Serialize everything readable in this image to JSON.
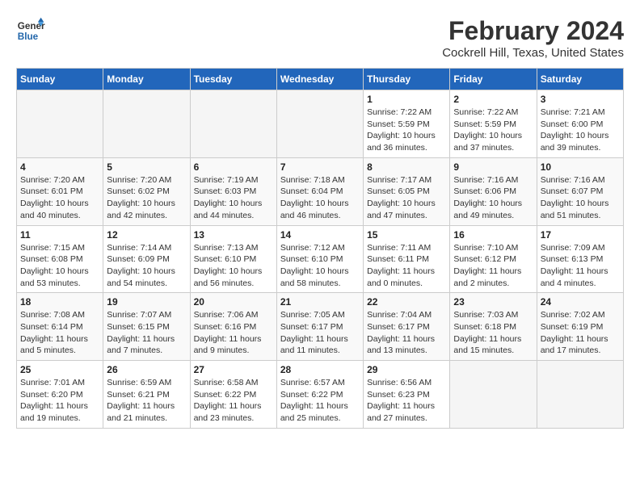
{
  "header": {
    "logo_line1": "General",
    "logo_line2": "Blue",
    "title": "February 2024",
    "subtitle": "Cockrell Hill, Texas, United States"
  },
  "weekdays": [
    "Sunday",
    "Monday",
    "Tuesday",
    "Wednesday",
    "Thursday",
    "Friday",
    "Saturday"
  ],
  "weeks": [
    [
      {
        "day": "",
        "sunrise": "",
        "sunset": "",
        "daylight": ""
      },
      {
        "day": "",
        "sunrise": "",
        "sunset": "",
        "daylight": ""
      },
      {
        "day": "",
        "sunrise": "",
        "sunset": "",
        "daylight": ""
      },
      {
        "day": "",
        "sunrise": "",
        "sunset": "",
        "daylight": ""
      },
      {
        "day": "1",
        "sunrise": "Sunrise: 7:22 AM",
        "sunset": "Sunset: 5:59 PM",
        "daylight": "Daylight: 10 hours and 36 minutes."
      },
      {
        "day": "2",
        "sunrise": "Sunrise: 7:22 AM",
        "sunset": "Sunset: 5:59 PM",
        "daylight": "Daylight: 10 hours and 37 minutes."
      },
      {
        "day": "3",
        "sunrise": "Sunrise: 7:21 AM",
        "sunset": "Sunset: 6:00 PM",
        "daylight": "Daylight: 10 hours and 39 minutes."
      }
    ],
    [
      {
        "day": "4",
        "sunrise": "Sunrise: 7:20 AM",
        "sunset": "Sunset: 6:01 PM",
        "daylight": "Daylight: 10 hours and 40 minutes."
      },
      {
        "day": "5",
        "sunrise": "Sunrise: 7:20 AM",
        "sunset": "Sunset: 6:02 PM",
        "daylight": "Daylight: 10 hours and 42 minutes."
      },
      {
        "day": "6",
        "sunrise": "Sunrise: 7:19 AM",
        "sunset": "Sunset: 6:03 PM",
        "daylight": "Daylight: 10 hours and 44 minutes."
      },
      {
        "day": "7",
        "sunrise": "Sunrise: 7:18 AM",
        "sunset": "Sunset: 6:04 PM",
        "daylight": "Daylight: 10 hours and 46 minutes."
      },
      {
        "day": "8",
        "sunrise": "Sunrise: 7:17 AM",
        "sunset": "Sunset: 6:05 PM",
        "daylight": "Daylight: 10 hours and 47 minutes."
      },
      {
        "day": "9",
        "sunrise": "Sunrise: 7:16 AM",
        "sunset": "Sunset: 6:06 PM",
        "daylight": "Daylight: 10 hours and 49 minutes."
      },
      {
        "day": "10",
        "sunrise": "Sunrise: 7:16 AM",
        "sunset": "Sunset: 6:07 PM",
        "daylight": "Daylight: 10 hours and 51 minutes."
      }
    ],
    [
      {
        "day": "11",
        "sunrise": "Sunrise: 7:15 AM",
        "sunset": "Sunset: 6:08 PM",
        "daylight": "Daylight: 10 hours and 53 minutes."
      },
      {
        "day": "12",
        "sunrise": "Sunrise: 7:14 AM",
        "sunset": "Sunset: 6:09 PM",
        "daylight": "Daylight: 10 hours and 54 minutes."
      },
      {
        "day": "13",
        "sunrise": "Sunrise: 7:13 AM",
        "sunset": "Sunset: 6:10 PM",
        "daylight": "Daylight: 10 hours and 56 minutes."
      },
      {
        "day": "14",
        "sunrise": "Sunrise: 7:12 AM",
        "sunset": "Sunset: 6:10 PM",
        "daylight": "Daylight: 10 hours and 58 minutes."
      },
      {
        "day": "15",
        "sunrise": "Sunrise: 7:11 AM",
        "sunset": "Sunset: 6:11 PM",
        "daylight": "Daylight: 11 hours and 0 minutes."
      },
      {
        "day": "16",
        "sunrise": "Sunrise: 7:10 AM",
        "sunset": "Sunset: 6:12 PM",
        "daylight": "Daylight: 11 hours and 2 minutes."
      },
      {
        "day": "17",
        "sunrise": "Sunrise: 7:09 AM",
        "sunset": "Sunset: 6:13 PM",
        "daylight": "Daylight: 11 hours and 4 minutes."
      }
    ],
    [
      {
        "day": "18",
        "sunrise": "Sunrise: 7:08 AM",
        "sunset": "Sunset: 6:14 PM",
        "daylight": "Daylight: 11 hours and 5 minutes."
      },
      {
        "day": "19",
        "sunrise": "Sunrise: 7:07 AM",
        "sunset": "Sunset: 6:15 PM",
        "daylight": "Daylight: 11 hours and 7 minutes."
      },
      {
        "day": "20",
        "sunrise": "Sunrise: 7:06 AM",
        "sunset": "Sunset: 6:16 PM",
        "daylight": "Daylight: 11 hours and 9 minutes."
      },
      {
        "day": "21",
        "sunrise": "Sunrise: 7:05 AM",
        "sunset": "Sunset: 6:17 PM",
        "daylight": "Daylight: 11 hours and 11 minutes."
      },
      {
        "day": "22",
        "sunrise": "Sunrise: 7:04 AM",
        "sunset": "Sunset: 6:17 PM",
        "daylight": "Daylight: 11 hours and 13 minutes."
      },
      {
        "day": "23",
        "sunrise": "Sunrise: 7:03 AM",
        "sunset": "Sunset: 6:18 PM",
        "daylight": "Daylight: 11 hours and 15 minutes."
      },
      {
        "day": "24",
        "sunrise": "Sunrise: 7:02 AM",
        "sunset": "Sunset: 6:19 PM",
        "daylight": "Daylight: 11 hours and 17 minutes."
      }
    ],
    [
      {
        "day": "25",
        "sunrise": "Sunrise: 7:01 AM",
        "sunset": "Sunset: 6:20 PM",
        "daylight": "Daylight: 11 hours and 19 minutes."
      },
      {
        "day": "26",
        "sunrise": "Sunrise: 6:59 AM",
        "sunset": "Sunset: 6:21 PM",
        "daylight": "Daylight: 11 hours and 21 minutes."
      },
      {
        "day": "27",
        "sunrise": "Sunrise: 6:58 AM",
        "sunset": "Sunset: 6:22 PM",
        "daylight": "Daylight: 11 hours and 23 minutes."
      },
      {
        "day": "28",
        "sunrise": "Sunrise: 6:57 AM",
        "sunset": "Sunset: 6:22 PM",
        "daylight": "Daylight: 11 hours and 25 minutes."
      },
      {
        "day": "29",
        "sunrise": "Sunrise: 6:56 AM",
        "sunset": "Sunset: 6:23 PM",
        "daylight": "Daylight: 11 hours and 27 minutes."
      },
      {
        "day": "",
        "sunrise": "",
        "sunset": "",
        "daylight": ""
      },
      {
        "day": "",
        "sunrise": "",
        "sunset": "",
        "daylight": ""
      }
    ]
  ]
}
